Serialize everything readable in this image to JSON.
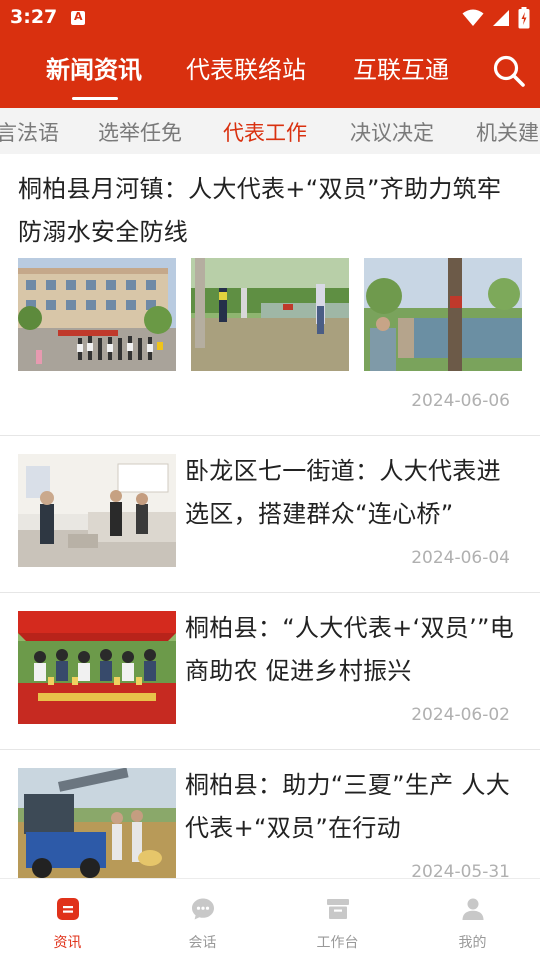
{
  "status_bar": {
    "time": "3:27",
    "icons": [
      "notification-app-icon",
      "wifi-icon",
      "signal-icon",
      "battery-icon"
    ]
  },
  "nav": {
    "tabs": [
      {
        "label": "新闻资讯",
        "active": true
      },
      {
        "label": "代表联络站",
        "active": false
      },
      {
        "label": "互联互通",
        "active": false
      }
    ],
    "search_icon": "search-icon"
  },
  "subtabs": [
    {
      "label": "言法语",
      "active": false
    },
    {
      "label": "选举任免",
      "active": false
    },
    {
      "label": "代表工作",
      "active": true
    },
    {
      "label": "决议决定",
      "active": false
    },
    {
      "label": "机关建",
      "active": false
    }
  ],
  "news": [
    {
      "title_line1": "桐柏县月河镇：人大代表+“双员”齐助力筑牢",
      "title_line2": "防溺水安全防线",
      "date": "2024-06-06",
      "images": [
        "school-building-crowd-photo",
        "pond-inspection-photo",
        "tree-warning-sign-photo"
      ]
    },
    {
      "title_line1": "卧龙区七一街道：人大代表进",
      "title_line2": "选区，搭建群众“连心桥”",
      "date": "2024-06-04",
      "image": "meeting-room-photo"
    },
    {
      "title_line1": "桐柏县：“人大代表+‘双员’”电",
      "title_line2": "商助农 促进乡村振兴",
      "date": "2024-06-02",
      "image": "red-tent-market-photo"
    },
    {
      "title_line1": "桐柏县：助力“三夏”生产 人大",
      "title_line2": "代表+“双员”在行动",
      "date": "2024-05-31",
      "image": "harvest-truck-photo"
    }
  ],
  "bottom_nav": [
    {
      "label": "资讯",
      "icon": "news-icon",
      "active": true
    },
    {
      "label": "会话",
      "icon": "chat-icon",
      "active": false
    },
    {
      "label": "工作台",
      "icon": "workbench-icon",
      "active": false
    },
    {
      "label": "我的",
      "icon": "profile-icon",
      "active": false
    }
  ],
  "colors": {
    "brand_red": "#d9300f",
    "active_tab_text": "#d9300f",
    "inactive_text": "#7a7a7a",
    "date_text": "#b0b0b0"
  }
}
